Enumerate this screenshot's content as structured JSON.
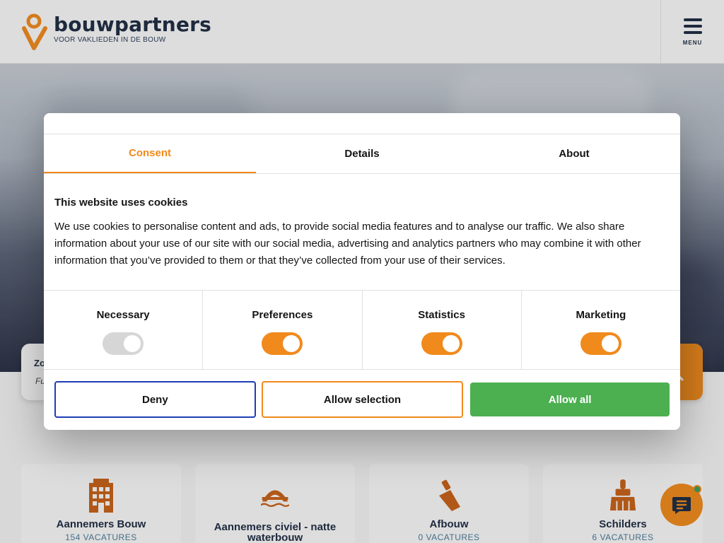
{
  "brand": {
    "name": "bouwpartners",
    "tagline": "VOOR VAKLIEDEN IN DE BOUW",
    "accent_color": "#f08a1d",
    "navy_color": "#1f2d44"
  },
  "header": {
    "menu_label": "MENU"
  },
  "search": {
    "label": "Zo",
    "sub": "Fu"
  },
  "categories": [
    {
      "title": "Aannemers Bouw",
      "count": "154 VACATURES",
      "icon": "building-icon"
    },
    {
      "title": "Aannemers civiel - natte waterbouw",
      "count": "",
      "icon": "bridge-icon"
    },
    {
      "title": "Afbouw",
      "count": "0 VACATURES",
      "icon": "trowel-icon"
    },
    {
      "title": "Schilders",
      "count": "6 VACATURES",
      "icon": "paintbrush-icon"
    }
  ],
  "cookie": {
    "tabs": [
      "Consent",
      "Details",
      "About"
    ],
    "active_tab": "Consent",
    "title": "This website uses cookies",
    "text": "We use cookies to personalise content and ads, to provide social media features and to analyse our traffic. We also share information about your use of our site with our social media, advertising and analytics partners who may combine it with other information that you’ve provided to them or that they’ve collected from your use of their services.",
    "toggles": [
      {
        "label": "Necessary",
        "on": true,
        "disabled": true
      },
      {
        "label": "Preferences",
        "on": true,
        "disabled": false
      },
      {
        "label": "Statistics",
        "on": true,
        "disabled": false
      },
      {
        "label": "Marketing",
        "on": true,
        "disabled": false
      }
    ],
    "buttons": {
      "deny": "Deny",
      "allow_selection": "Allow selection",
      "allow_all": "Allow all"
    },
    "colors": {
      "deny_border": "#1d3db5",
      "allow_all_bg": "#4caf50"
    }
  }
}
